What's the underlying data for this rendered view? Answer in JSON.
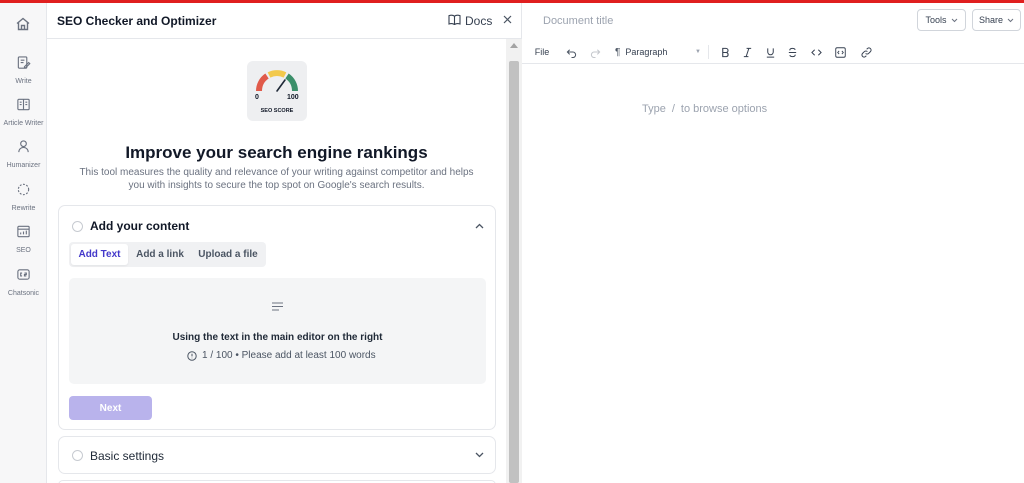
{
  "colors": {
    "accent": "#4338ca",
    "next_button": "#b9b3ec",
    "top_strip": "#e01f1f",
    "gauge": [
      "#e05a4a",
      "#f2c94c",
      "#3b8f6a"
    ]
  },
  "rail": {
    "home_icon": "home-icon",
    "items": [
      {
        "label": "Write",
        "icon": "write-icon"
      },
      {
        "label": "Article Writer",
        "icon": "article-icon"
      },
      {
        "label": "Humanizer",
        "icon": "person-icon"
      },
      {
        "label": "Rewrite",
        "icon": "rewrite-icon"
      },
      {
        "label": "SEO",
        "icon": "seo-icon"
      },
      {
        "label": "Chatsonic",
        "icon": "chat-icon"
      }
    ]
  },
  "panel": {
    "title": "SEO Checker and Optimizer",
    "docs_label": "Docs",
    "score": {
      "min": "0",
      "max": "100",
      "label": "SEO SCORE"
    },
    "heading": "Improve your search engine rankings",
    "description": "This tool measures the quality and relevance of your writing against competitor and helps you with insights to secure the top spot on Google's search results.",
    "content_card": {
      "title": "Add your content",
      "tabs": [
        "Add Text",
        "Add a link",
        "Upload a file"
      ],
      "active_tab": "Add Text",
      "drop_main": "Using the text in the main editor on the right",
      "drop_sub": "1 / 100 • Please add at least 100 words",
      "next_label": "Next"
    },
    "basic_card": {
      "title": "Basic settings"
    }
  },
  "editor": {
    "title_placeholder": "Document title",
    "tools_label": "Tools",
    "share_label": "Share",
    "toolbar": {
      "file_label": "File",
      "paragraph_label": "Paragraph"
    },
    "hint_type": "Type",
    "hint_slash": "/",
    "hint_rest": "to browse options"
  }
}
